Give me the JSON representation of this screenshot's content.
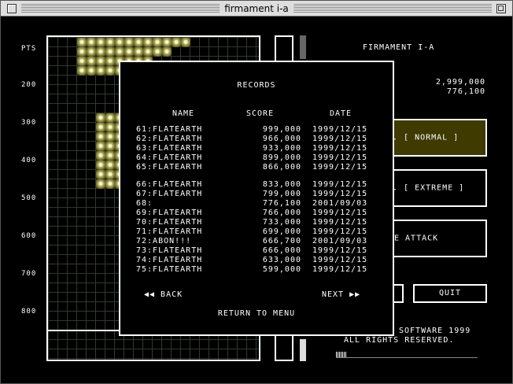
{
  "window": {
    "title": "firmament i-a"
  },
  "playfield": {
    "row_labels": [
      "PTS",
      "200",
      "300",
      "400",
      "500",
      "600",
      "700",
      "800"
    ]
  },
  "right_panel": {
    "title": "FIRMAMENT I-A",
    "hiscore_1": "2,999,000",
    "hiscore_2": "776,100",
    "mode_normal": ". [ NORMAL ]",
    "mode_extreme": ". [ EXTREME ]",
    "mode_attack": "E ATTACK",
    "quit": "QUIT",
    "copyright_1": "SOFTWARE 1999",
    "copyright_2": "ALL RIGHTS RESERVED."
  },
  "records": {
    "heading": "RECORDS",
    "col_name": "NAME",
    "col_score": "SCORE",
    "col_date": "DATE",
    "rows": [
      {
        "name": "61:FLATEARTH",
        "score": "999,000",
        "date": "1999/12/15"
      },
      {
        "name": "62:FLATEARTH",
        "score": "966,000",
        "date": "1999/12/15"
      },
      {
        "name": "63:FLATEARTH",
        "score": "933,000",
        "date": "1999/12/15"
      },
      {
        "name": "64:FLATEARTH",
        "score": "899,000",
        "date": "1999/12/15"
      },
      {
        "name": "65:FLATEARTH",
        "score": "866,000",
        "date": "1999/12/15"
      },
      {
        "name": "66:FLATEARTH",
        "score": "833,000",
        "date": "1999/12/15"
      },
      {
        "name": "67:FLATEARTH",
        "score": "799,000",
        "date": "1999/12/15"
      },
      {
        "name": "68:",
        "score": "776,100",
        "date": "2001/09/03"
      },
      {
        "name": "69:FLATEARTH",
        "score": "766,000",
        "date": "1999/12/15"
      },
      {
        "name": "70:FLATEARTH",
        "score": "733,000",
        "date": "1999/12/15"
      },
      {
        "name": "71:FLATEARTH",
        "score": "699,000",
        "date": "1999/12/15"
      },
      {
        "name": "72:ABON!!!",
        "score": "666,700",
        "date": "2001/09/03"
      },
      {
        "name": "73:FLATEARTH",
        "score": "666,000",
        "date": "1999/12/15"
      },
      {
        "name": "74:FLATEARTH",
        "score": "633,000",
        "date": "1999/12/15"
      },
      {
        "name": "75:FLATEARTH",
        "score": "599,000",
        "date": "1999/12/15"
      }
    ],
    "back": "◀◀ BACK",
    "next": "NEXT ▶▶",
    "return_menu": "RETURN TO MENU"
  },
  "colors": {
    "accent": "#3e3a00",
    "grid": "#2e3a2e",
    "block": "#b9b76a"
  }
}
